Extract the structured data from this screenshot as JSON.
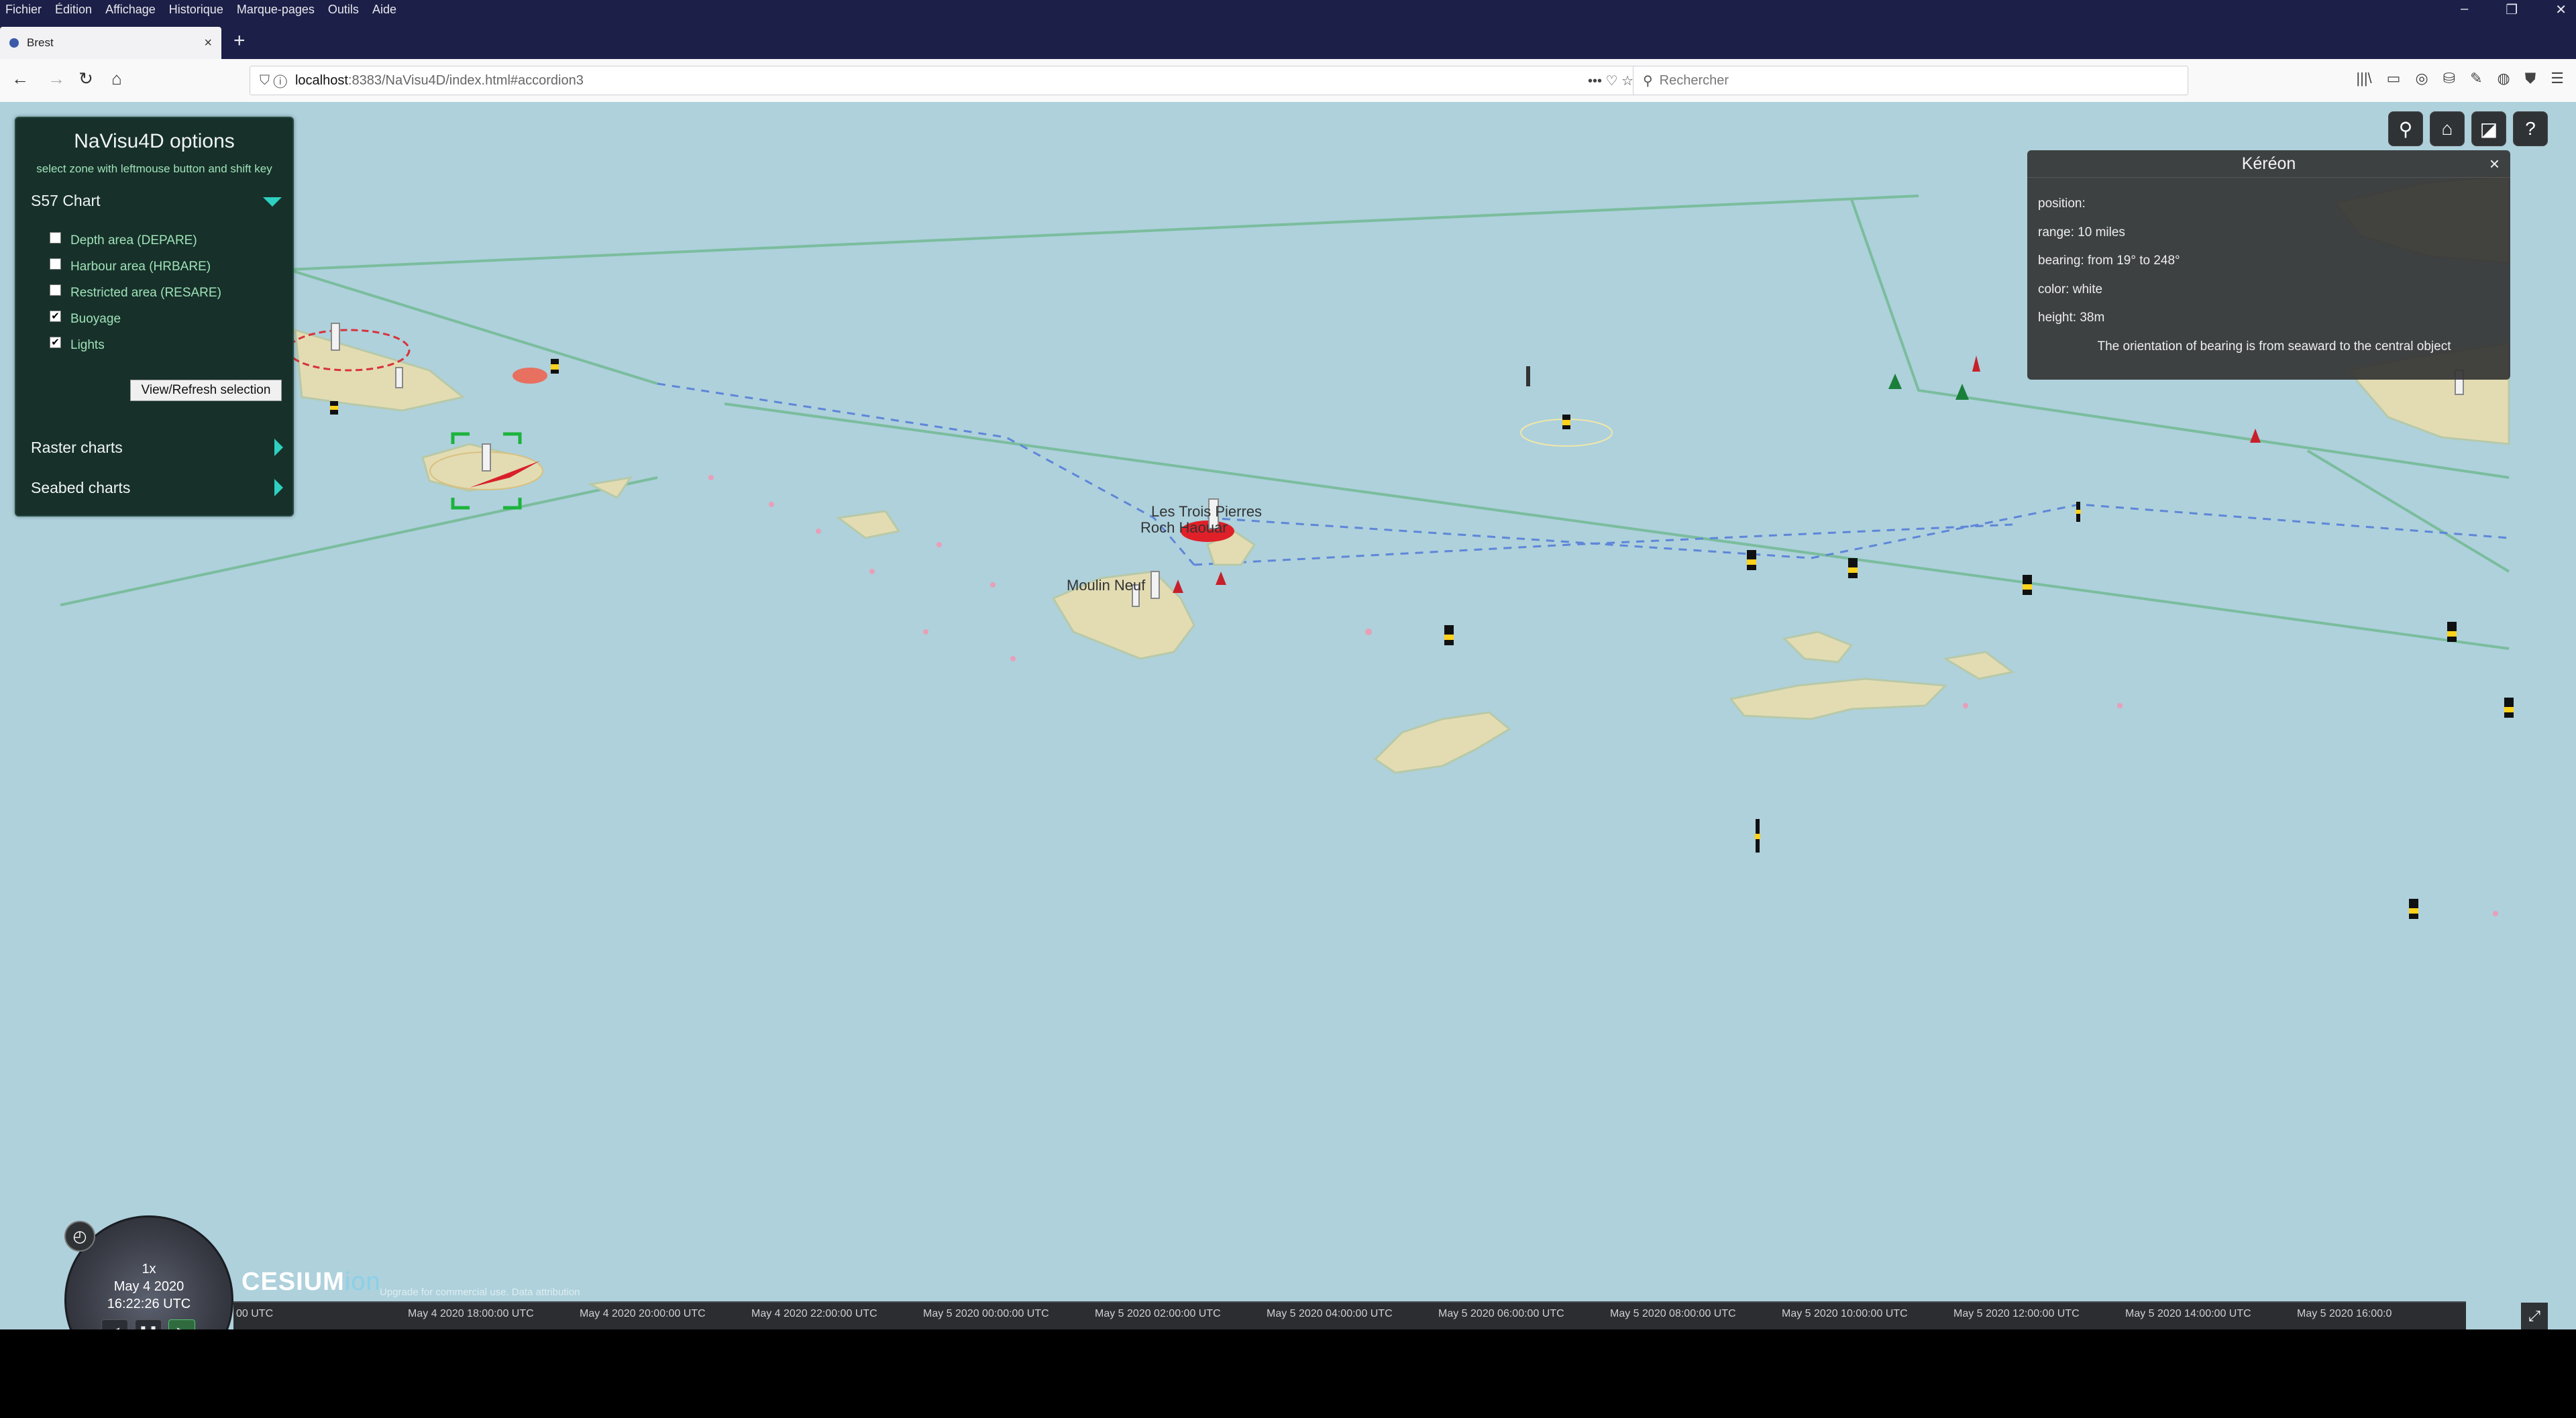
{
  "menu": [
    "Fichier",
    "Édition",
    "Affichage",
    "Historique",
    "Marque-pages",
    "Outils",
    "Aide"
  ],
  "window_controls": {
    "minimize": "–",
    "maximize": "❐",
    "close": "✕"
  },
  "tab": {
    "title": "Brest",
    "close": "×",
    "new_tab": "+"
  },
  "nav": {
    "back": "←",
    "forward": "→",
    "reload": "↻",
    "home": "⌂",
    "url_host": "localhost",
    "url_path": ":8383/NaVisu4D/index.html#accordion3",
    "url_actions": "•••  ♡  ☆",
    "search_placeholder": "Rechercher"
  },
  "toolbar_icons": [
    "|||\\",
    "▭",
    "◎",
    "⛁",
    "✎",
    "◍",
    "⛊",
    "☰"
  ],
  "options": {
    "title": "NaVisu4D options",
    "hint": "select zone with leftmouse button and shift key",
    "s57": {
      "label": "S57 Chart",
      "expanded": true
    },
    "layers": [
      {
        "label": "Depth area (DEPARE)",
        "checked": false
      },
      {
        "label": "Harbour area (HRBARE)",
        "checked": false
      },
      {
        "label": "Restricted area (RESARE)",
        "checked": false
      },
      {
        "label": "Buoyage",
        "checked": true
      },
      {
        "label": "Lights",
        "checked": true
      }
    ],
    "refresh_button": "View/Refresh selection",
    "raster": {
      "label": "Raster charts"
    },
    "seabed": {
      "label": "Seabed charts"
    }
  },
  "info": {
    "title": "Kéréon",
    "close": "×",
    "rows": [
      "position:",
      "range: 10 miles",
      "bearing: from 19° to 248°",
      "color: white",
      "height: 38m"
    ],
    "note": "The orientation of bearing is from seaward to the central object"
  },
  "widgets": {
    "search": "⚲",
    "home": "⌂",
    "mode": "◪",
    "help": "?"
  },
  "map_labels": [
    "Les Trois Pierres",
    "Roch Haouar",
    "Moulin Neuf"
  ],
  "animation": {
    "speed": "1x",
    "date": "May 4 2020",
    "time": "16:22:26 UTC",
    "rewind": "◀",
    "pause": "❚❚",
    "play": "▶",
    "clock": "◴"
  },
  "cesium": {
    "brand": "CESIUM",
    "suffix": "ion",
    "credits": "Upgrade for commercial use.  Data attribution"
  },
  "timeline": {
    "ticks": [
      "00 UTC",
      "May 4 2020 18:00:00 UTC",
      "May 4 2020 20:00:00 UTC",
      "May 4 2020 22:00:00 UTC",
      "May 5 2020 00:00:00 UTC",
      "May 5 2020 02:00:00 UTC",
      "May 5 2020 04:00:00 UTC",
      "May 5 2020 06:00:00 UTC",
      "May 5 2020 08:00:00 UTC",
      "May 5 2020 10:00:00 UTC",
      "May 5 2020 12:00:00 UTC",
      "May 5 2020 14:00:00 UTC",
      "May 5 2020 16:00:0"
    ],
    "fullscreen": "⤢"
  },
  "colors": {
    "sea": "#aed1dc",
    "land": "#e3dcb3",
    "panel": "#17302a",
    "accent": "#2ed0c0"
  }
}
